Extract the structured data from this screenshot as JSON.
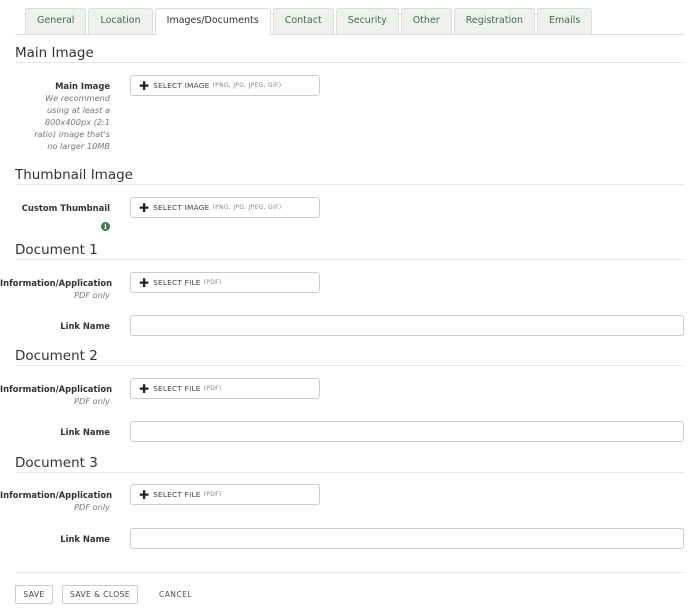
{
  "tabs": [
    {
      "label": "General"
    },
    {
      "label": "Location"
    },
    {
      "label": "Images/Documents",
      "active": true
    },
    {
      "label": "Contact"
    },
    {
      "label": "Security"
    },
    {
      "label": "Other"
    },
    {
      "label": "Registration"
    },
    {
      "label": "Emails"
    }
  ],
  "main_image": {
    "title": "Main Image",
    "field_label": "Main Image",
    "hint_lines": [
      "We recommend",
      "using at least a",
      "800x400px (2:1",
      "ratio) image that's",
      "no larger 10MB"
    ],
    "button_label": "SELECT IMAGE",
    "button_types": "(PNG, JPG, JPEG, GIF)"
  },
  "thumbnail": {
    "title": "Thumbnail Image",
    "field_label": "Custom Thumbnail",
    "info_icon": "i",
    "button_label": "SELECT IMAGE",
    "button_types": "(PNG, JPG, JPEG, GIF)"
  },
  "documents": [
    {
      "title": "Document 1",
      "field_label": "Information/Application",
      "hint": "PDF only",
      "button_label": "SELECT FILE",
      "button_types": "(PDF)",
      "link_name_label": "Link Name",
      "link_name_value": ""
    },
    {
      "title": "Document 2",
      "field_label": "Information/Application",
      "hint": "PDF only",
      "button_label": "SELECT FILE",
      "button_types": "(PDF)",
      "link_name_label": "Link Name",
      "link_name_value": ""
    },
    {
      "title": "Document 3",
      "field_label": "Information/Application",
      "hint": "PDF only",
      "button_label": "SELECT FILE",
      "button_types": "(PDF)",
      "link_name_label": "Link Name",
      "link_name_value": ""
    }
  ],
  "footer": {
    "save_label": "SAVE",
    "save_close_label": "SAVE & CLOSE",
    "cancel_label": "CANCEL"
  },
  "icons": {
    "plus": "✚"
  }
}
